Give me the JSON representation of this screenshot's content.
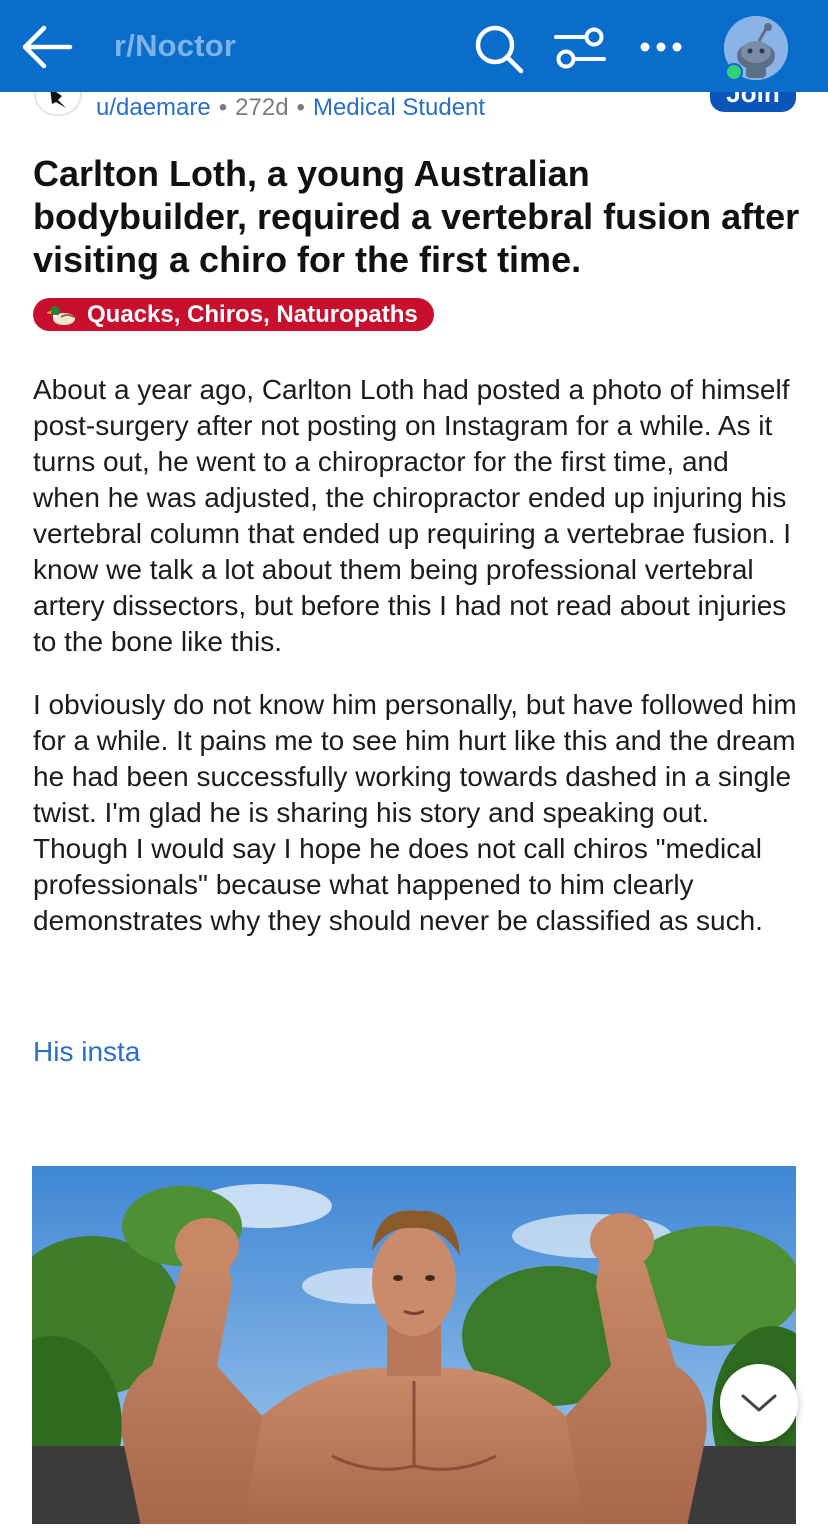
{
  "header": {
    "subreddit": "r/Noctor",
    "icons": [
      "back-arrow-icon",
      "search-icon",
      "filter-icon",
      "more-icon",
      "avatar-icon"
    ],
    "colors": {
      "bar": "#0a6ccb",
      "title": "#7fb2e6",
      "online": "#2fd27a"
    }
  },
  "author": {
    "username": "u/daemare",
    "age": "272d",
    "user_flair": "Medical Student",
    "separator": "•",
    "join_label": "Join"
  },
  "post": {
    "title": "Carlton Loth, a young Australian bodybuilder, required a vertebral fusion after visiting a chiro for the first time.",
    "flair": {
      "label": "Quacks, Chiros, Naturopaths",
      "icon": "duck-icon",
      "color": "#c8102e"
    },
    "paragraphs": [
      "About a year ago, Carlton Loth had posted a photo of himself post-surgery after not posting on Instagram for a while. As it turns out, he went to a chiropractor for the first time, and when he was adjusted, the chiropractor ended up injuring his vertebral column that ended up requiring a vertebrae fusion. I know we talk a lot about them being professional vertebral artery dissectors, but before this I had not read about injuries to the bone like this.",
      "I obviously do not know him personally, but have followed him for a while. It pains me to see him hurt like this and the dream he had been successfully working towards dashed in a single twist. I'm glad he is sharing his story and speaking out. Though I would say I hope he does not call chiros \"medical professionals\" because what happened to him clearly demonstrates why they should never be classified as such."
    ],
    "link_label": "His insta",
    "image": {
      "icon": "photo-bodybuilder-flexing"
    }
  },
  "controls": {
    "scroll_icon": "chevron-down-icon"
  }
}
